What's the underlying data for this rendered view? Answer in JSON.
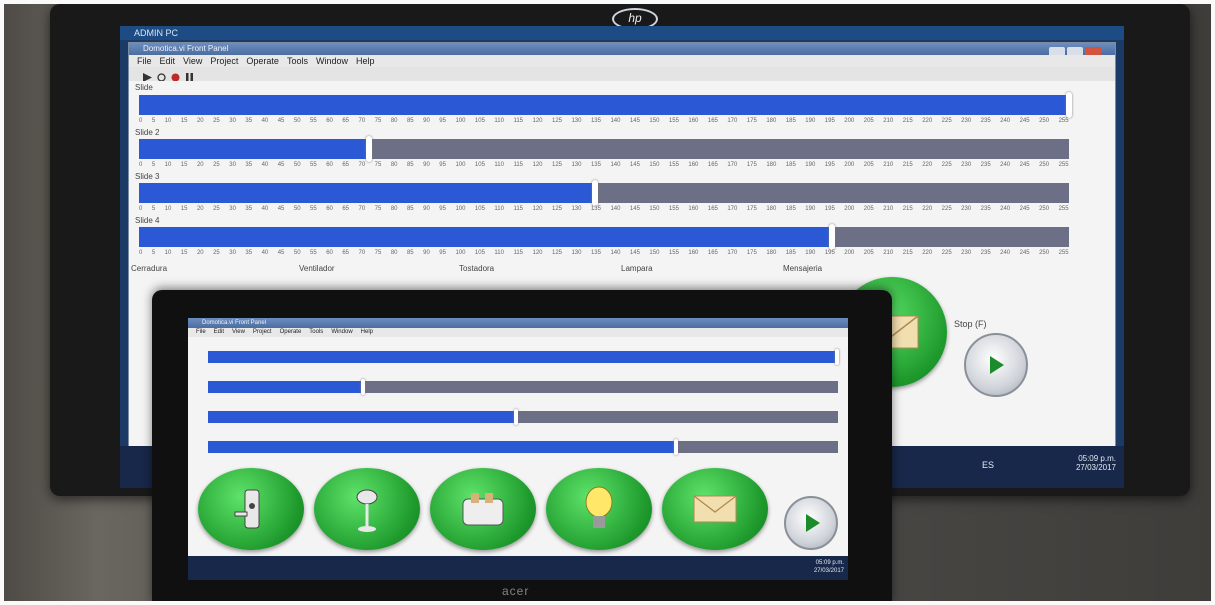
{
  "brands": {
    "monitor": "hp",
    "laptop": "acer"
  },
  "window": {
    "tab_title": "ADMIN PC",
    "app_title": "Domotica.vi Front Panel",
    "menu": [
      "File",
      "Edit",
      "View",
      "Project",
      "Operate",
      "Tools",
      "Window",
      "Help"
    ]
  },
  "sliders": [
    {
      "label": "Slide",
      "value": 255
    },
    {
      "label": "Slide 2",
      "value": 63
    },
    {
      "label": "Slide 3",
      "value": 125
    },
    {
      "label": "Slide 4",
      "value": 190
    }
  ],
  "scale_ticks": [
    "0",
    "5",
    "10",
    "15",
    "20",
    "25",
    "30",
    "35",
    "40",
    "45",
    "50",
    "55",
    "60",
    "65",
    "70",
    "75",
    "80",
    "85",
    "90",
    "95",
    "100",
    "105",
    "110",
    "115",
    "120",
    "125",
    "130",
    "135",
    "140",
    "145",
    "150",
    "155",
    "160",
    "165",
    "170",
    "175",
    "180",
    "185",
    "190",
    "195",
    "200",
    "205",
    "210",
    "215",
    "220",
    "225",
    "230",
    "235",
    "240",
    "245",
    "250",
    "255"
  ],
  "button_labels": [
    "Cerradura",
    "Ventilador",
    "Tostadora",
    "Lampara",
    "Mensajeria"
  ],
  "buttons": [
    {
      "icon": "door-lock-icon"
    },
    {
      "icon": "fan-icon"
    },
    {
      "icon": "toaster-icon"
    },
    {
      "icon": "light-bulb-icon"
    },
    {
      "icon": "envelope-icon"
    }
  ],
  "stop_label": "Stop (F)",
  "clock": {
    "time": "05:09 p.m.",
    "date": "27/03/2017"
  },
  "taskbar_lang": "ES",
  "colors": {
    "slider_fill": "#2b59d6",
    "slider_track": "#6c6f85",
    "button_green": "#2ea83c",
    "taskbar": "#18284a"
  }
}
